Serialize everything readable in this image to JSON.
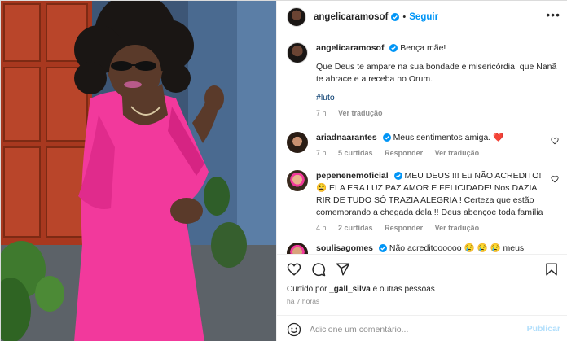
{
  "post": {
    "author": "angelicaramosof",
    "follow_label": "Seguir",
    "separator": "•",
    "more_label": "•••",
    "caption_line1": "Bença mãe!",
    "caption_line2": "Que Deus te ampare na sua bondade e misericórdia, que Nanã te abrace e a receba no Orum.",
    "hashtag": "#luto",
    "caption_time": "7 h",
    "see_translation": "Ver tradução"
  },
  "comments": [
    {
      "user": "ariadnaarantes",
      "text": "Meus sentimentos amiga. ❤️",
      "time": "7 h",
      "likes": "5 curtidas",
      "reply": "Responder",
      "translate": "Ver tradução"
    },
    {
      "user": "pepenenemoficial",
      "text": "MEU DEUS !!! Eu NÃO ACREDITO!😩 ELA ERA LUZ PAZ AMOR E FELICIDADE! Nos DAZIA RIR DE TUDO SÓ TRAZIA ALEGRIA ! Certeza que estão comemorando a chegada dela !! Deus abençoe toda família",
      "time": "4 h",
      "likes": "2 curtidas",
      "reply": "Responder",
      "translate": "Ver tradução"
    },
    {
      "user": "soulisagomes",
      "text": "Não acreditoooooo 😢 😢 😢 meus"
    }
  ],
  "likes": {
    "prefix": "Curtido por",
    "user": "_gall_silva",
    "suffix": "e outras pessoas"
  },
  "timestamp": "há 7 horas",
  "add_comment": {
    "placeholder": "Adicione um comentário...",
    "publish_label": "Publicar"
  },
  "colors": {
    "accent": "#0095f6",
    "verified": "#0095f6",
    "heart": "#ed4956",
    "muted": "#8e8e8e",
    "dress": "#f2399c"
  },
  "icons": [
    "heart-icon",
    "comment-icon",
    "share-icon",
    "bookmark-icon",
    "emoji-icon",
    "verified-icon",
    "more-icon"
  ]
}
